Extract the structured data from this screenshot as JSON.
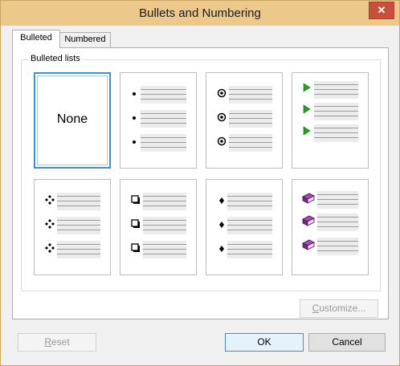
{
  "window": {
    "title": "Bullets and Numbering",
    "close_glyph": "✕"
  },
  "tabs": [
    {
      "label": "Bulleted",
      "active": true
    },
    {
      "label": "Numbered",
      "active": false
    }
  ],
  "group": {
    "label": "Bulleted lists"
  },
  "bullet_styles": [
    {
      "label": "None",
      "selected": true
    },
    {
      "icon": "small-dot-bullet-icon",
      "selected": false
    },
    {
      "icon": "circled-dot-bullet-icon",
      "selected": false
    },
    {
      "icon": "green-arrow-bullet-icon",
      "selected": false
    },
    {
      "icon": "four-diamond-bullet-icon",
      "selected": false
    },
    {
      "icon": "hollow-square-bullet-icon",
      "selected": false
    },
    {
      "icon": "small-diamond-bullet-icon",
      "selected": false
    },
    {
      "icon": "purple-book-bullet-icon",
      "selected": false
    }
  ],
  "buttons": {
    "customize": {
      "first": "C",
      "rest": "ustomize...",
      "enabled": false
    },
    "reset": {
      "first": "R",
      "rest": "eset",
      "enabled": false
    },
    "ok": "OK",
    "cancel": "Cancel"
  },
  "colors": {
    "title_bar": "#ecc98a",
    "selection_border": "#3c8fd9",
    "close_button": "#c7503c",
    "arrow_bullet": "#1fa31f",
    "book_bullet": "#7a2a86"
  }
}
